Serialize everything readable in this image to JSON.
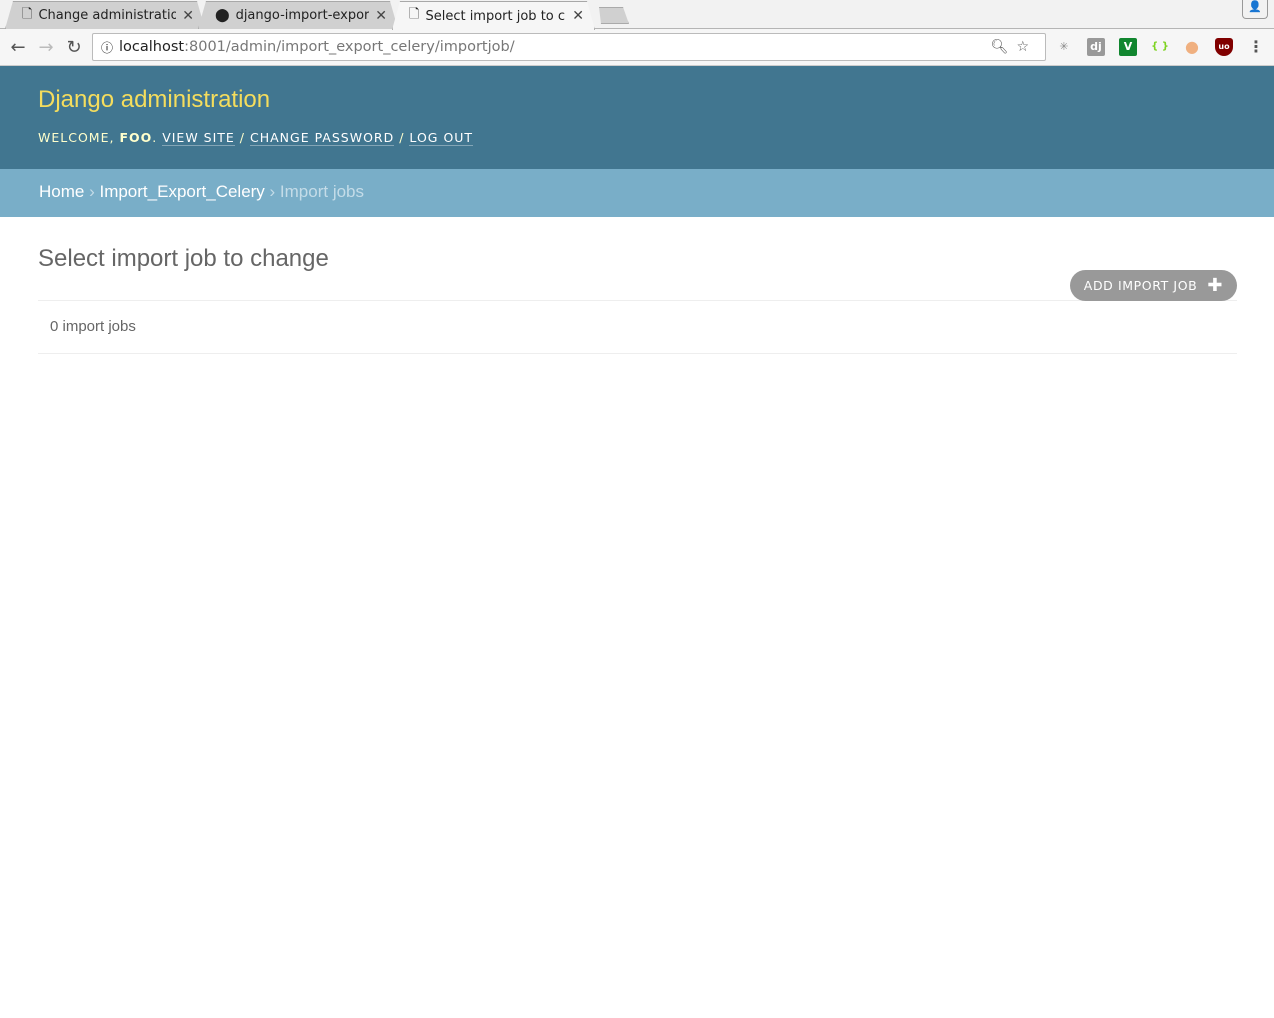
{
  "browser": {
    "tabs": [
      {
        "title": "Change administratio",
        "icon": "page-icon"
      },
      {
        "title": "django-import-export",
        "icon": "github-icon"
      },
      {
        "title": "Select import job to c",
        "icon": "page-icon"
      }
    ],
    "url_host": "localhost",
    "url_path": ":8001/admin/import_export_celery/importjob/",
    "extensions": [
      {
        "name": "spark",
        "label": "✳",
        "color": "#888888"
      },
      {
        "name": "django",
        "label": "dj",
        "color": "#999999"
      },
      {
        "name": "v",
        "label": "V",
        "color": "#11862f"
      },
      {
        "name": "json",
        "label": "{ }",
        "color": "#7ed321"
      },
      {
        "name": "orange",
        "label": "●",
        "color": "#f0b080"
      },
      {
        "name": "ublock",
        "label": "uo",
        "color": "#800000"
      }
    ]
  },
  "header": {
    "site_name": "Django administration",
    "welcome": "Welcome,",
    "user": "foo",
    "view_site": "View site",
    "change_password": "Change password",
    "log_out": "Log out"
  },
  "breadcrumbs": {
    "home": "Home",
    "app": "Import_Export_Celery",
    "current": "Import jobs"
  },
  "main": {
    "title": "Select import job to change",
    "add_button": "Add import job",
    "plus": "✚",
    "count": "0 import jobs"
  },
  "colors": {
    "header_bg": "#417690",
    "breadcrumb_bg": "#79aec8",
    "site_name": "#f5dd5d",
    "button_bg": "#999999"
  }
}
